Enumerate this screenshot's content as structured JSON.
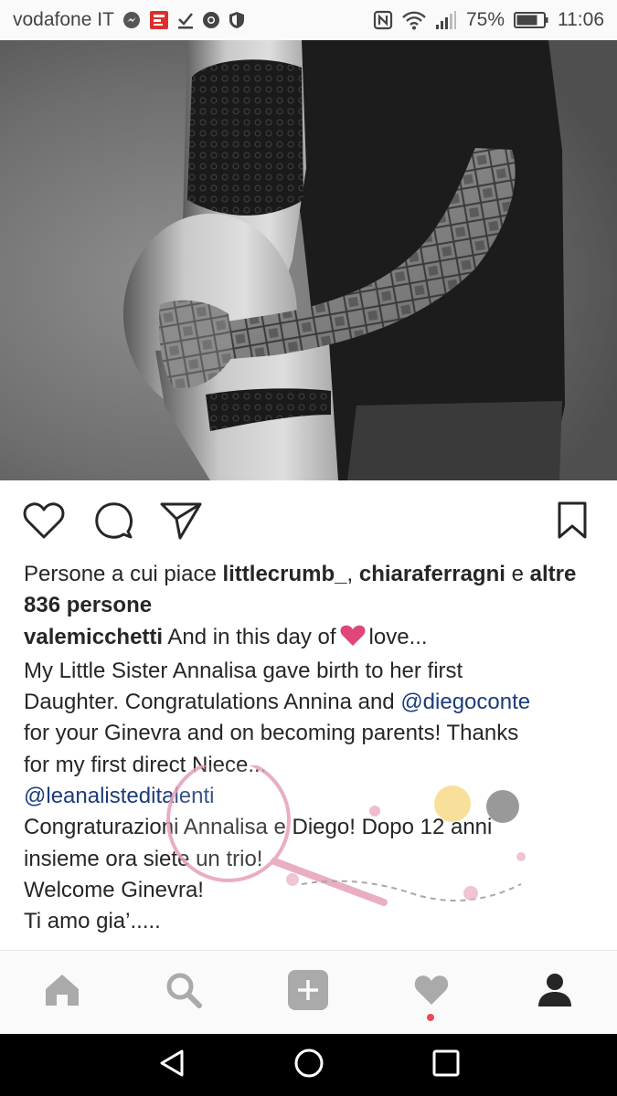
{
  "status_bar": {
    "carrier": "vodafone IT",
    "battery": "75%",
    "time": "11:06",
    "icons": [
      "messenger-icon",
      "app-notification-icon",
      "download-done-icon",
      "chrome-icon",
      "shield-icon",
      "nfc-icon",
      "wifi-icon",
      "signal-icon",
      "battery-icon"
    ]
  },
  "post": {
    "image_alt": "black and white maternity photo",
    "actions": [
      "heart-icon",
      "comment-icon",
      "share-icon",
      "bookmark-icon"
    ],
    "likes": {
      "prefix": "Persone a cui piace ",
      "user1": "littlecrumb_",
      "separator": ", ",
      "user2": "chiaraferragni",
      "conjunction": " e ",
      "others": "altre",
      "others_count": "836 persone"
    },
    "caption": {
      "username": "valemicchetti",
      "text_before_heart": " And in this day of",
      "text_after_heart": "love...",
      "line2": "My Little Sister Annalisa gave birth to her first",
      "line3_before": "Daughter. Congratulations Annina and ",
      "mention1": "@diegoconte",
      "line4": "for your Ginevra and on becoming parents! Thanks",
      "line5": "for my first direct Niece...",
      "mention2": "@leanalisteditalenti",
      "line7": "Congraturazioni Annalisa e Diego! Dopo 12 anni",
      "line8": "insieme ora siete un trio!",
      "line9": "Welcome Ginevra!",
      "line10": "Ti amo gia’....."
    }
  },
  "bottom_nav": {
    "items": [
      "home-icon",
      "search-icon",
      "add-post-icon",
      "activity-heart-icon",
      "profile-icon"
    ]
  },
  "system_nav": {
    "items": [
      "back-icon",
      "home-circle-icon",
      "recents-icon"
    ]
  },
  "colors": {
    "text": "#262626",
    "mention": "#1d3b7a",
    "heart_emoji": "#e0457b",
    "nav_inactive": "#aaaaaa",
    "nav_active": "#262626",
    "notification_dot": "#ed4956"
  }
}
